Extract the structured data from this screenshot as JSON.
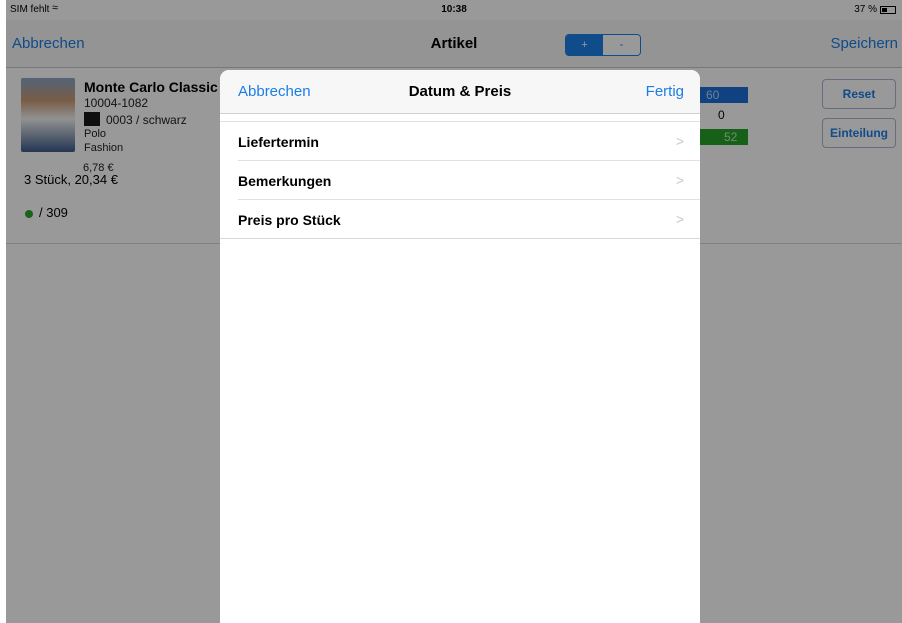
{
  "status_bar": {
    "carrier": "SIM fehlt",
    "wifi_icon": "wifi-icon",
    "time": "10:38",
    "battery": "37 %",
    "battery_icon": "battery-icon"
  },
  "nav": {
    "cancel_label": "Abbrechen",
    "title": "Artikel",
    "save_label": "Speichern",
    "segment": [
      "+",
      "-"
    ]
  },
  "article": {
    "name": "Monte Carlo Classic",
    "number": "10004-1082",
    "color": "0003 / schwarz",
    "category1": "Polo",
    "category2": "Fashion",
    "unit_price": "6,78 €",
    "total": "3 Stück, 20,34 €",
    "stock": "/ 309",
    "qty_blue": "60",
    "qty_zero": "0",
    "qty_green": "52",
    "reset_label": "Reset",
    "einteilung_label": "Einteilung"
  },
  "modal": {
    "cancel_label": "Abbrechen",
    "title": "Datum & Preis",
    "done_label": "Fertig",
    "rows": [
      {
        "label": "Liefertermin",
        "chevron": ">"
      },
      {
        "label": "Bemerkungen",
        "chevron": ">"
      },
      {
        "label": "Preis pro Stück",
        "chevron": ">"
      }
    ]
  },
  "colors": {
    "accent": "#1b7de6",
    "stock_green": "#2aa52a",
    "qty_blue": "#1b6fd8",
    "qty_green": "#27a027"
  }
}
